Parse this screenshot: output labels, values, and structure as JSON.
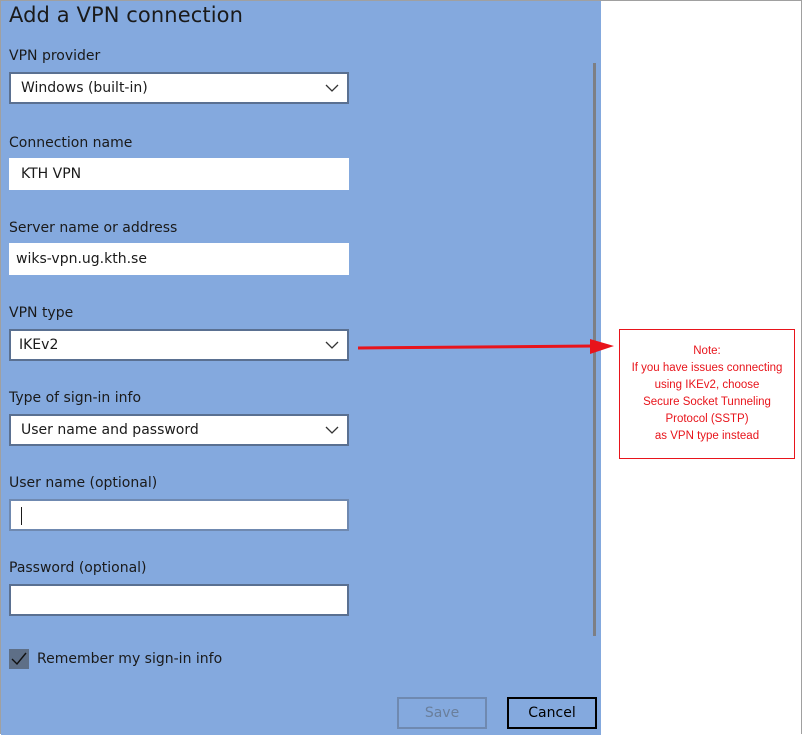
{
  "dialog": {
    "title": "Add a VPN connection",
    "fields": {
      "vpn_provider": {
        "label": "VPN provider",
        "value": "Windows (built-in)",
        "type": "dropdown"
      },
      "connection_name": {
        "label": "Connection name",
        "value": "KTH VPN",
        "type": "text"
      },
      "server": {
        "label": "Server name or address",
        "value": "wiks-vpn.ug.kth.se",
        "type": "text"
      },
      "vpn_type": {
        "label": "VPN type",
        "value": "IKEv2",
        "type": "dropdown"
      },
      "signin_type": {
        "label": "Type of sign-in info",
        "value": "User name and password",
        "type": "dropdown"
      },
      "username": {
        "label": "User name (optional)",
        "value": "",
        "type": "text"
      },
      "password": {
        "label": "Password (optional)",
        "value": "",
        "type": "password"
      }
    },
    "remember": {
      "label": "Remember my sign-in info",
      "checked": true
    },
    "buttons": {
      "save": "Save",
      "cancel": "Cancel"
    },
    "icons": {
      "dropdown": "chevron-down-icon",
      "checkbox": "checkmark-icon"
    }
  },
  "annotation": {
    "lines": [
      "Note:",
      "If you have issues connecting",
      "using IKEv2, choose",
      "Secure Socket Tunneling",
      "Protocol (SSTP)",
      "as VPN type instead"
    ],
    "color": "#e8141b",
    "arrow_target": "vpn-type-dropdown"
  },
  "colors": {
    "panel_background": "#84a9de",
    "field_border": "#5a7091"
  }
}
